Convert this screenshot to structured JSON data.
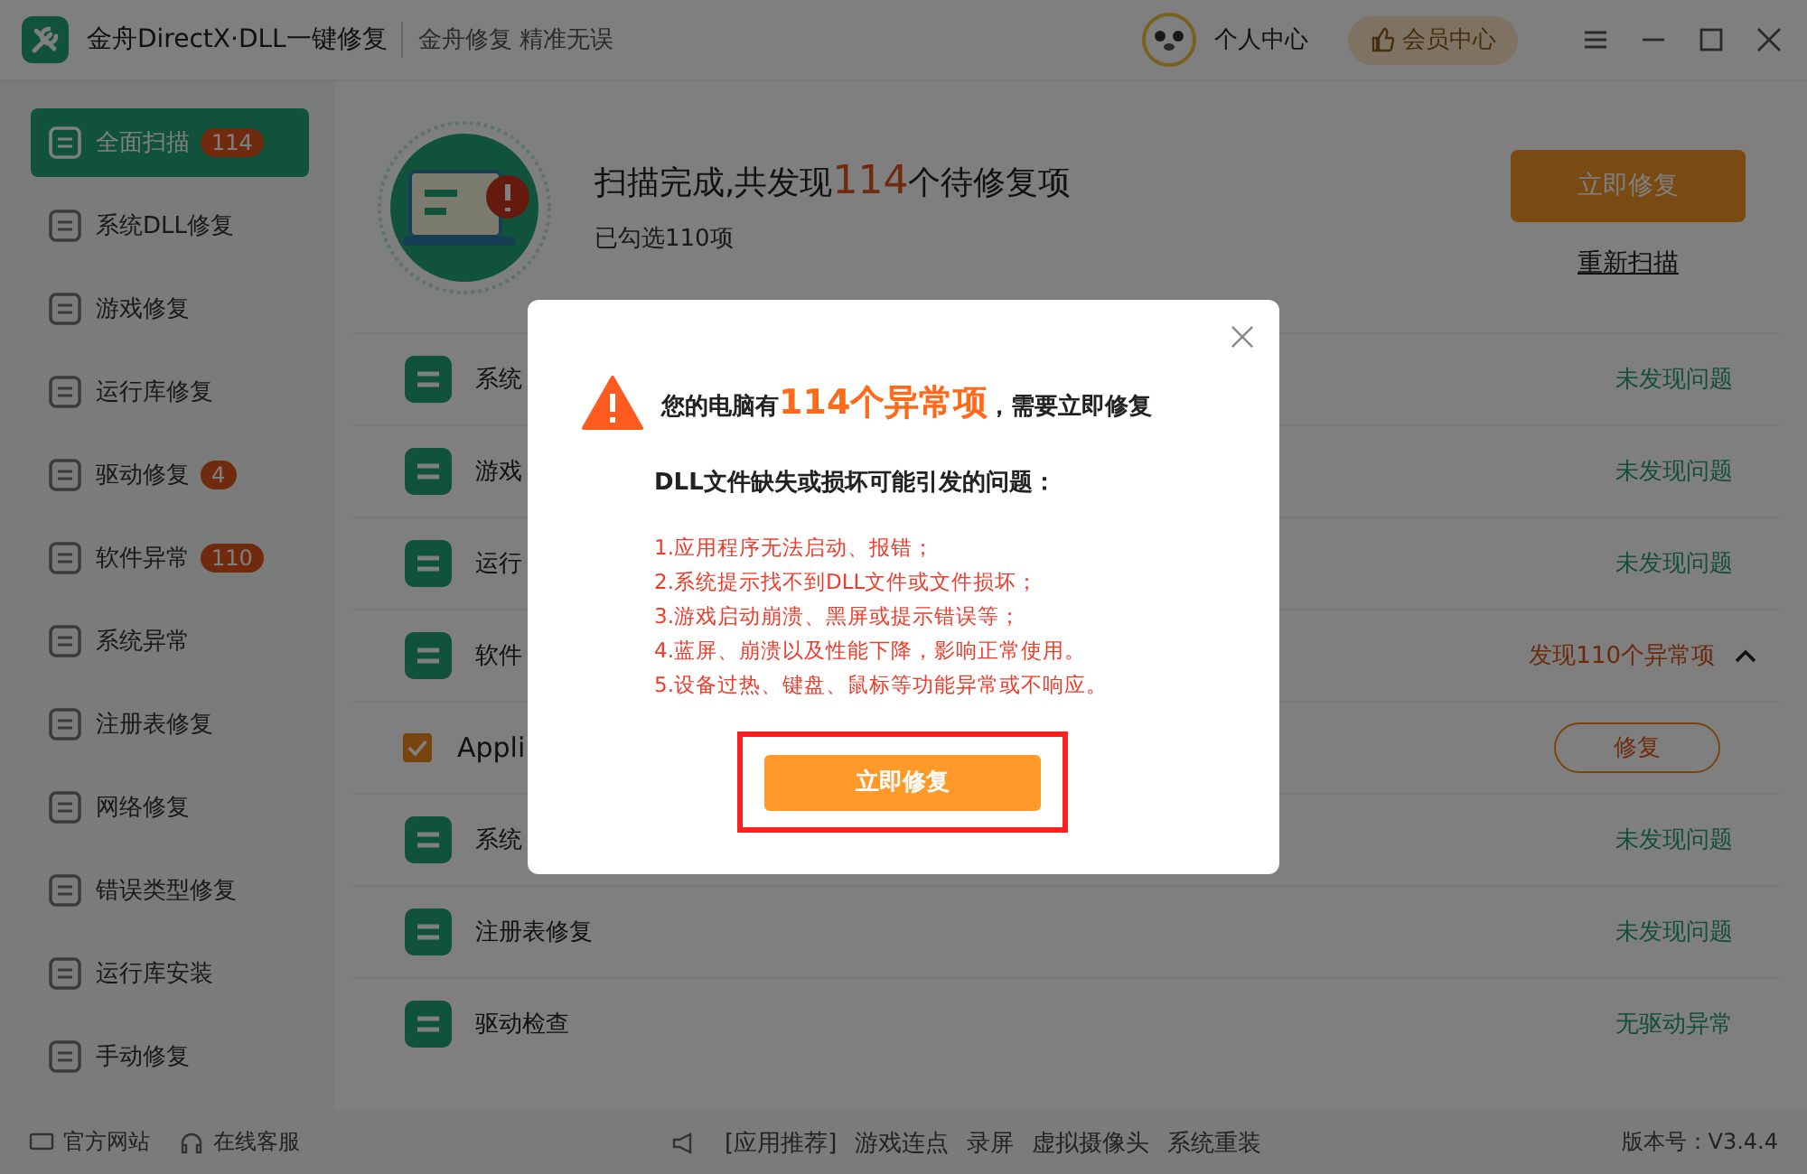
{
  "title_bar": {
    "app_title": "金舟DirectX·DLL一键修复",
    "slogan": "金舟修复 精准无误",
    "user_center": "个人中心",
    "vip_center": "会员中心"
  },
  "sidebar": {
    "items": [
      {
        "label": "全面扫描",
        "badge": "114",
        "selected": true
      },
      {
        "label": "系统DLL修复",
        "selected": false
      },
      {
        "label": "游戏修复",
        "selected": false
      },
      {
        "label": "运行库修复",
        "selected": false
      },
      {
        "label": "驱动修复",
        "badge": "4",
        "selected": false
      },
      {
        "label": "软件异常",
        "badge": "110",
        "selected": false
      },
      {
        "label": "系统异常",
        "selected": false
      },
      {
        "label": "注册表修复",
        "selected": false
      },
      {
        "label": "网络修复",
        "selected": false
      },
      {
        "label": "错误类型修复",
        "selected": false
      },
      {
        "label": "运行库安装",
        "selected": false
      },
      {
        "label": "手动修复",
        "selected": false
      }
    ]
  },
  "summary": {
    "title_prefix": "扫描完成,共发现",
    "count": "114",
    "title_suffix": "个待修复项",
    "selected_note": "已勾选110项",
    "fix_button": "立即修复",
    "rescan_link": "重新扫描"
  },
  "rows": [
    {
      "kind": "category",
      "label": "系统",
      "status": "未发现问题",
      "has_issues": false
    },
    {
      "kind": "category",
      "label": "游戏",
      "status": "未发现问题",
      "has_issues": false
    },
    {
      "kind": "category",
      "label": "运行",
      "status": "未发现问题",
      "has_issues": false
    },
    {
      "kind": "category",
      "label": "软件",
      "status": "发现110个异常项",
      "has_issues": true,
      "expanded": true
    },
    {
      "kind": "item",
      "label": "Appli",
      "checked": true,
      "action": "修复"
    },
    {
      "kind": "category",
      "label": "系统",
      "status": "未发现问题",
      "has_issues": false
    },
    {
      "kind": "category",
      "label": "注册表修复",
      "status": "未发现问题",
      "has_issues": false
    },
    {
      "kind": "category",
      "label": "驱动检查",
      "status": "无驱动异常",
      "has_issues": false
    }
  ],
  "dialog": {
    "title_prefix": "您的电脑有",
    "title_highlight": "114个异常项",
    "title_suffix": "，需要立即修复",
    "subtitle": "DLL文件缺失或损坏可能引发的问题：",
    "issues": [
      "1.应用程序无法启动、报错；",
      "2.系统提示找不到DLL文件或文件损坏；",
      "3.游戏启动崩溃、黑屏或提示错误等；",
      "4.蓝屏、崩溃以及性能下降，影响正常使用。",
      "5.设备过热、键盘、鼠标等功能异常或不响应。"
    ],
    "fix_button": "立即修复"
  },
  "footer": {
    "links": [
      "官方网站",
      "在线客服"
    ],
    "promo": [
      "[应用推荐]",
      "游戏连点",
      "录屏",
      "虚拟摄像头",
      "系统重装"
    ],
    "version": "版本号：V3.4.4"
  }
}
